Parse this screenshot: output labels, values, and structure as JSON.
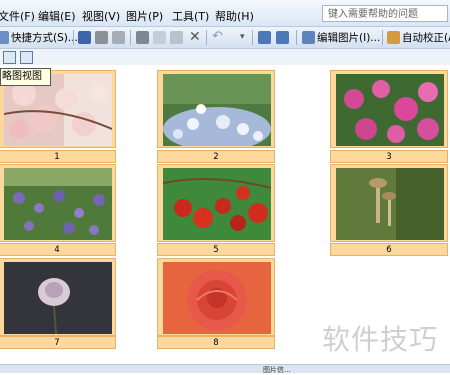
{
  "menu": [
    "文件(F)",
    "编辑(E)",
    "视图(V)",
    "图片(P)",
    "工具(T)",
    "帮助(H)"
  ],
  "help_placeholder": "键入需要帮助的问题",
  "toolbar": {
    "shortcut_label": "快捷方式(S)...",
    "edit_picture_label": "编辑图片(I)...",
    "auto_correct_label": "自动校正(A)"
  },
  "tooltip": "略图视图",
  "thumbnails": [
    {
      "number": "1",
      "subject": "pink blossoms"
    },
    {
      "number": "2",
      "subject": "white flowers"
    },
    {
      "number": "3",
      "subject": "pink cosmos"
    },
    {
      "number": "4",
      "subject": "purple flowers"
    },
    {
      "number": "5",
      "subject": "red berries"
    },
    {
      "number": "6",
      "subject": "mushrooms"
    },
    {
      "number": "7",
      "subject": "white rose"
    },
    {
      "number": "8",
      "subject": "red rose"
    }
  ],
  "watermark": "软件技巧",
  "status_partial": "图片信..."
}
